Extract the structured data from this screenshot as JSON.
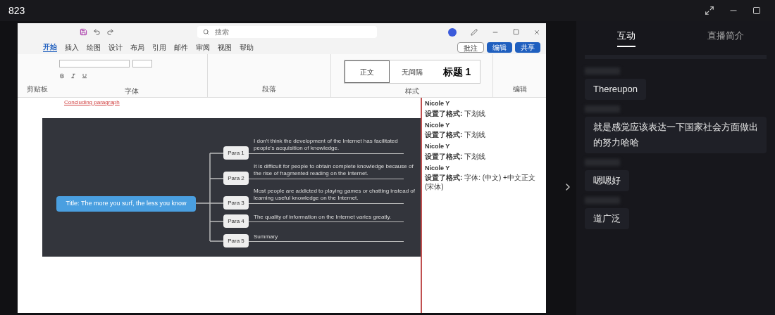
{
  "window": {
    "title": "823"
  },
  "word": {
    "search": {
      "placeholder": "搜索"
    },
    "ribbon_tabs": [
      {
        "label": "开始",
        "selected": true
      },
      {
        "label": "插入",
        "selected": false
      },
      {
        "label": "绘图",
        "selected": false
      },
      {
        "label": "设计",
        "selected": false
      },
      {
        "label": "布局",
        "selected": false
      },
      {
        "label": "引用",
        "selected": false
      },
      {
        "label": "邮件",
        "selected": false
      },
      {
        "label": "审阅",
        "selected": false
      },
      {
        "label": "视图",
        "selected": false
      },
      {
        "label": "帮助",
        "selected": false
      }
    ],
    "top_buttons": [
      {
        "label": "批注",
        "kind": "outline"
      },
      {
        "label": "编辑",
        "kind": "primary"
      },
      {
        "label": "共享",
        "kind": "primary"
      }
    ],
    "styles": [
      {
        "label": "正文",
        "selected": true,
        "kind": "normal"
      },
      {
        "label": "无间隔",
        "selected": false,
        "kind": "normal"
      },
      {
        "label": "标题 1",
        "selected": false,
        "kind": "heading"
      }
    ],
    "groups": [
      "剪贴板",
      "字体",
      "段落",
      "样式",
      "编辑"
    ],
    "doc_link": "Concluding paragraph",
    "mind_map": {
      "title": "Title: The more you surf, the less you know",
      "branches": [
        {
          "label": "Para 1",
          "text": "I don't think the development of the Internet has facilitated people's acquisition of knowledge."
        },
        {
          "label": "Para 2",
          "text": "It is difficult for people to obtain complete knowledge because of the rise of fragmented reading on the Internet."
        },
        {
          "label": "Para 3",
          "text": "Most people are addicted to playing games or chatting instead of learning useful knowledge on the Internet."
        },
        {
          "label": "Para 4",
          "text": "The quality of information on the Internet varies greatly."
        },
        {
          "label": "Para 5",
          "text": "Summary"
        }
      ]
    },
    "revisions": [
      {
        "author": "Nicole Y",
        "action": "设置了格式:",
        "detail": "下划线"
      },
      {
        "author": "Nicole Y",
        "action": "设置了格式:",
        "detail": "下划线"
      },
      {
        "author": "Nicole Y",
        "action": "设置了格式:",
        "detail": "下划线"
      },
      {
        "author": "Nicole Y",
        "action": "设置了格式:",
        "detail": "字体: (中文) +中文正文 (宋体)"
      }
    ]
  },
  "side_tabs": [
    {
      "label": "互动",
      "selected": true
    },
    {
      "label": "直播简介",
      "selected": false
    }
  ],
  "messages": [
    {
      "text": "Thereupon"
    },
    {
      "text": "就是感觉应该表达一下国家社会方面做出的努力哈哈"
    },
    {
      "text": "嗯嗯好"
    },
    {
      "text": "道广泛"
    }
  ]
}
